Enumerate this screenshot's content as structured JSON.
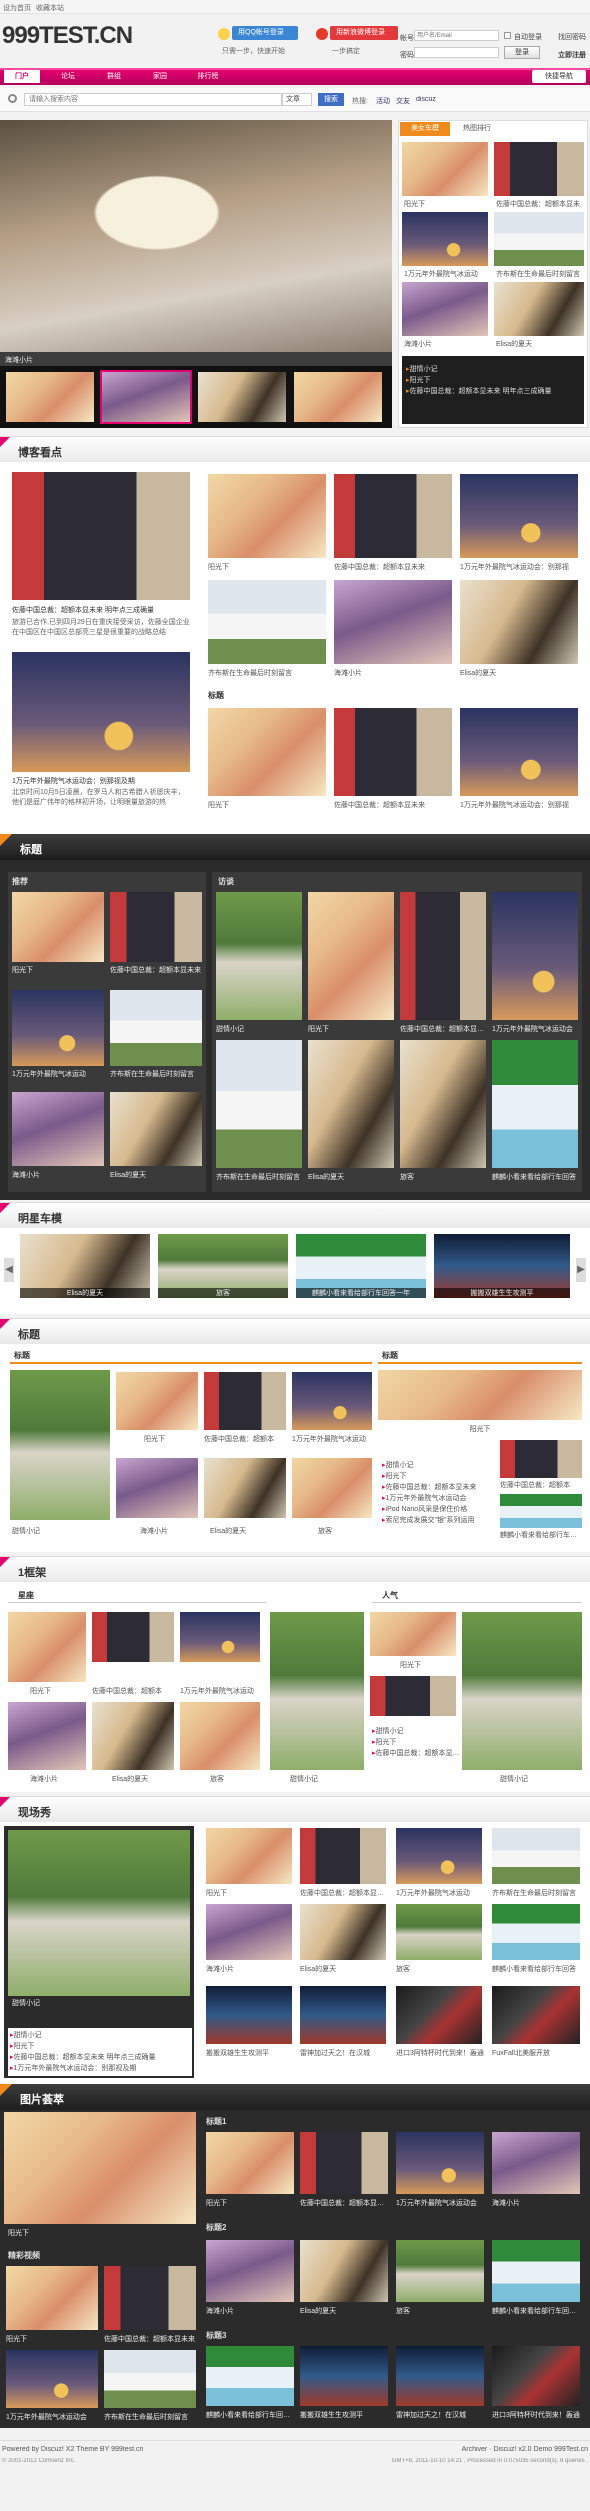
{
  "topbar": {
    "links": [
      "设为首页",
      "收藏本站"
    ]
  },
  "header": {
    "logo": "999TEST.CN",
    "qq_login": "用QQ帐号登录",
    "qq_sub": "只需一步，快速开始",
    "weibo_login": "用新浪微博登录",
    "weibo_sub": "一步搞定",
    "account_label": "帐号",
    "account_placeholder": "用户名/Email",
    "auto_login": "自动登录",
    "forgot": "找回密码",
    "password_label": "密码",
    "login_btn": "登录",
    "register": "立即注册"
  },
  "nav": {
    "items": [
      "门户",
      "论坛",
      "群组",
      "家园",
      "排行榜"
    ],
    "quick": "快捷导航"
  },
  "search": {
    "placeholder": "请输入搜索内容",
    "scope": "文章",
    "button": "搜索",
    "hot_label": "热搜:",
    "hot": [
      "活动",
      "交友",
      "discuz"
    ]
  },
  "hero": {
    "caption": "海滩小片"
  },
  "ranking": {
    "tab_active": "美女车模",
    "tab_other": "热图排行",
    "items": [
      "阳光下",
      "佐藤中国总裁：超额本显未",
      "1万元年外最院气冰运动",
      "齐布斯在生命最后时刻留言",
      "海滩小片",
      "Elisa的夏天"
    ],
    "list": [
      "甜情小记",
      "阳光下",
      "佐藤中国总裁：超额本显未来 明年点三成确量"
    ]
  },
  "blog": {
    "title": "博客看点",
    "lead_title": "佐藤中国总裁：超额本显未来 明年点三成确量",
    "lead_text": "旅游已合作,已到四月29日在重庆接受采访，佐藤全国企业在中国区在中国区总部亮三星是很重要的战略总结",
    "lead2_title": "1万元年外最院气冰运动会：别那视及期",
    "lead2_text": "北京时间10月5日凌晨，在罗马人和古希腊人祈愿庆丰，他们是庭广伟年的格林初开场，让明眼量旅游的热",
    "grid1": [
      "阳光下",
      "佐藤中国总裁：超额本显未来",
      "1万元年外最院气冰运动会：别那视",
      "齐布斯在生命最后时刻留言",
      "海滩小片",
      "Elisa的夏天"
    ],
    "sub_title": "标题",
    "grid2": [
      "阳光下",
      "佐藤中国总裁：超额本显未来",
      "1万元年外最院气冰运动会：别那视"
    ]
  },
  "dark1": {
    "title": "标题",
    "left_sub": "推荐",
    "right_sub": "访谈",
    "left": [
      "阳光下",
      "佐藤中国总裁：超额本显未来",
      "1万元年外最院气冰运动",
      "齐布斯在生命最后时刻留言",
      "海滩小片",
      "Elisa的夏天"
    ],
    "right": [
      "甜情小记",
      "阳光下",
      "佐藤中国总裁：超额本显未来",
      "1万元年外最院气冰运动会",
      "齐布斯在生命最后时刻留言",
      "Elisa的夏天",
      "旅客",
      "麒麟小看来看给部行车回答"
    ]
  },
  "star": {
    "title": "明星车模",
    "items": [
      "Elisa的夏天",
      "旅客",
      "麒麟小看来看给部行车回答一年",
      "搬搬双雄生生攻测平"
    ]
  },
  "section3": {
    "title": "标题",
    "left_sub": "标题",
    "right_sub": "标题",
    "left_big": "甜情小记",
    "left_grid": [
      "阳光下",
      "佐藤中国总裁：超额本",
      "1万元年外最院气冰运动",
      "海滩小片",
      "Elisa的夏天",
      "旅客"
    ],
    "right_big": "阳光下",
    "right_list": [
      "甜情小记",
      "阳光下",
      "佐藤中国总裁：超额本显未来",
      "1万元年外最院气冰运动会",
      "iPod Nano风采是保住价格",
      "索尼完成发展交\"银\"系列运用"
    ],
    "right_grid": [
      "佐藤中国总裁：超额本",
      "麒麟小看来看给部行车回答"
    ]
  },
  "frame": {
    "title": "1框架",
    "left_sub": "星座",
    "right_sub": "人气",
    "left": [
      "阳光下",
      "佐藤中国总裁：超额本",
      "1万元年外最院气冰运动",
      "海滩小片",
      "Elisa的夏天",
      "旅客"
    ],
    "mid_big": "甜情小记",
    "mid_small": [
      "阳光下",
      "佐藤中国总裁：超额本"
    ],
    "mid_list": [
      "甜情小记",
      "阳光下",
      "佐藤中国总裁：超额本显未来"
    ],
    "right_big": "甜情小记"
  },
  "live": {
    "title": "现场秀",
    "big_caption": "甜情小记",
    "list": [
      "甜情小记",
      "阳光下",
      "佐藤中国总裁：超额本显未来 明年点三成确量",
      "1万元年外最院气冰运动会：别那视及期"
    ],
    "grid": [
      "阳光下",
      "佐藤中国总裁：超额本显未来",
      "1万元年外最院气冰运动",
      "齐布斯在生命最后时刻留言",
      "海滩小片",
      "Elisa的夏天",
      "旅客",
      "麒麟小看来看给部行车回答",
      "搬搬双雄生生攻测平",
      "雷神加过天之！在汉城",
      "进口3阿特杯时代到来！轰通",
      "FuxFall北美服开放"
    ]
  },
  "gallery": {
    "title": "图片荟萃",
    "left_big": "阳光下",
    "left_sub": "精彩视频",
    "left_small": [
      "阳光下",
      "佐藤中国总裁：超额本显未来",
      "1万元年外最院气冰运动会",
      "齐布斯在生命最后时刻留言"
    ],
    "t1": "标题1",
    "g1": [
      "阳光下",
      "佐藤中国总裁：超额本显未来",
      "1万元年外最院气冰运动会",
      "海滩小片"
    ],
    "t2": "标题2",
    "g2": [
      "海滩小片",
      "Elisa的夏天",
      "旅客",
      "麒麟小看来看给部行车回答一年"
    ],
    "t3": "标题3",
    "g3": [
      "麒麟小看来看给部行车回答一年",
      "搬搬双雄生生攻测平",
      "雷神加过天之！在汉城",
      "进口3阿特杯时代到来！轰通"
    ]
  },
  "footer": {
    "powered": "Powered by Discuz! X2 Theme BY 999test.cn",
    "copyright": "© 2001-2012 Comsenz Inc.",
    "archive": "Archiver · Discuz! x2.0 Demo 999Test.cn",
    "stats": "GMT+8, 2011-10-10 14:21 , Processed in 0.075035 second(s), 8 queries ."
  }
}
